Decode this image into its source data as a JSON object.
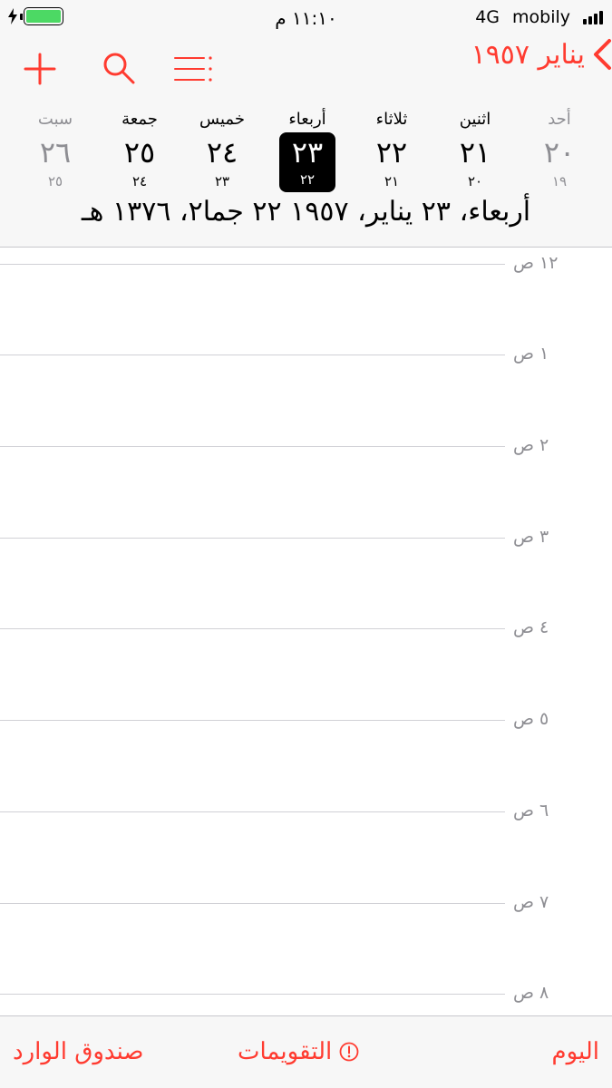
{
  "status_bar": {
    "time": "١١:١٠ م",
    "network": "4G",
    "carrier": "mobily",
    "battery_fill_percent": 100,
    "battery_color": "#4cd964"
  },
  "nav": {
    "back_label": "يناير ١٩٥٧",
    "add_icon": "plus-icon",
    "search_icon": "search-icon",
    "list_icon": "list-icon",
    "accent_color": "#ff3b30"
  },
  "week": {
    "days": [
      {
        "name": "سبت",
        "num": "٢٦",
        "hijri": "٢٥",
        "weekend": true,
        "selected": false
      },
      {
        "name": "جمعة",
        "num": "٢٥",
        "hijri": "٢٤",
        "weekend": false,
        "selected": false
      },
      {
        "name": "خميس",
        "num": "٢٤",
        "hijri": "٢٣",
        "weekend": false,
        "selected": false
      },
      {
        "name": "أربعاء",
        "num": "٢٣",
        "hijri": "٢٢",
        "weekend": false,
        "selected": true
      },
      {
        "name": "ثلاثاء",
        "num": "٢٢",
        "hijri": "٢١",
        "weekend": false,
        "selected": false
      },
      {
        "name": "اثنين",
        "num": "٢١",
        "hijri": "٢٠",
        "weekend": false,
        "selected": false
      },
      {
        "name": "أحد",
        "num": "٢٠",
        "hijri": "١٩",
        "weekend": true,
        "selected": false
      }
    ],
    "full_date": "أربعاء، ٢٣ يناير، ١٩٥٧   ٢٢ جما٢، ١٣٧٦ هـ"
  },
  "hours": [
    "١٢ ص",
    "١ ص",
    "٢ ص",
    "٣ ص",
    "٤ ص",
    "٥ ص",
    "٦ ص",
    "٧ ص",
    "٨ ص"
  ],
  "tabbar": {
    "inbox": "صندوق الوارد",
    "calendars": "التقويمات",
    "today": "اليوم",
    "calendars_icon": "alert-circle-icon"
  }
}
